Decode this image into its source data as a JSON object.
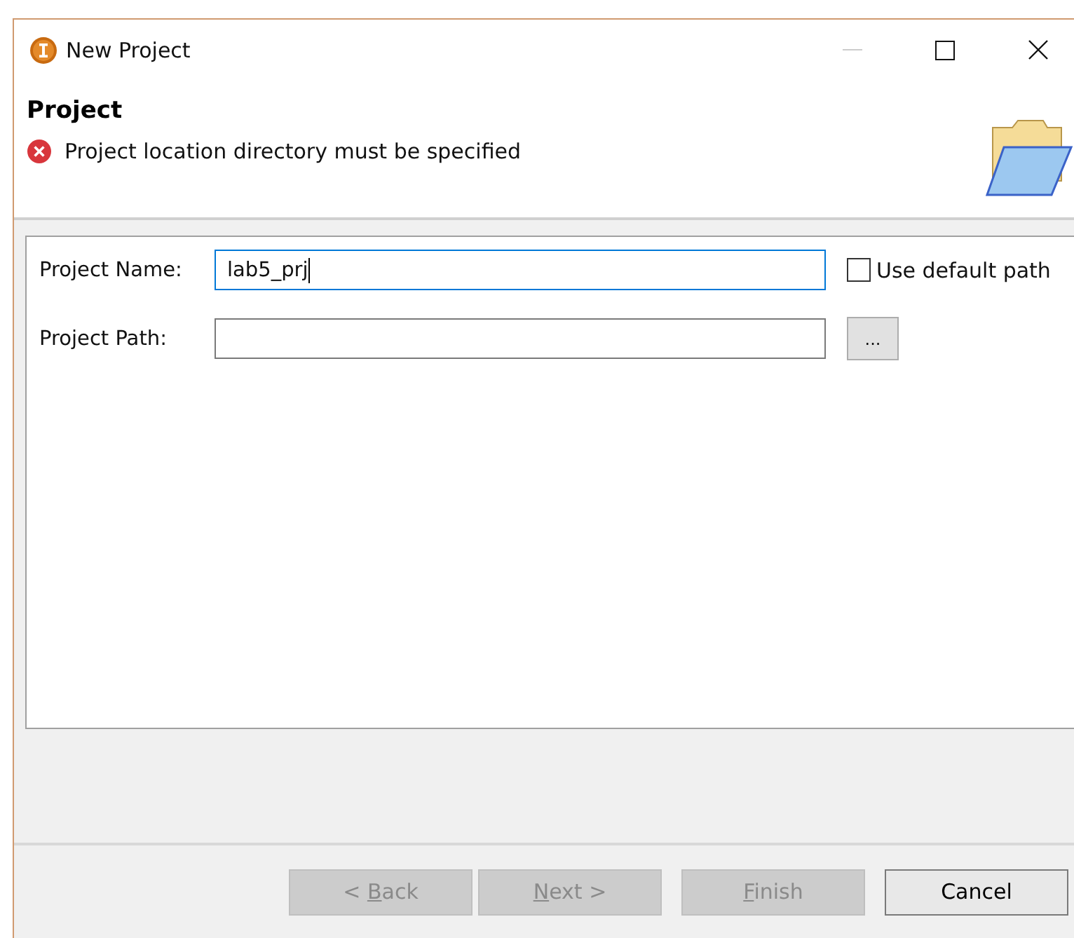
{
  "window": {
    "title": "New Project"
  },
  "header": {
    "title": "Project",
    "message": "Project location directory must be specified",
    "kind": "error"
  },
  "fields": [
    {
      "label": "Project Name:",
      "value": "lab5_prj",
      "focused": true,
      "kind": "name"
    },
    {
      "label": "Project Path:",
      "focused": false,
      "kind": "path",
      "browse_label": "..."
    }
  ],
  "default_path": {
    "label": "Use default path",
    "checked": false
  },
  "buttons": [
    {
      "label_before": "< ",
      "mnemonic": "B",
      "label_after": "ack",
      "disabled": true
    },
    {
      "mnemonic": "N",
      "label_after": "ext >",
      "disabled": true
    },
    {
      "mnemonic": "F",
      "label_after": "inish",
      "disabled": true
    },
    {
      "label_after": "Cancel",
      "disabled": false
    }
  ]
}
